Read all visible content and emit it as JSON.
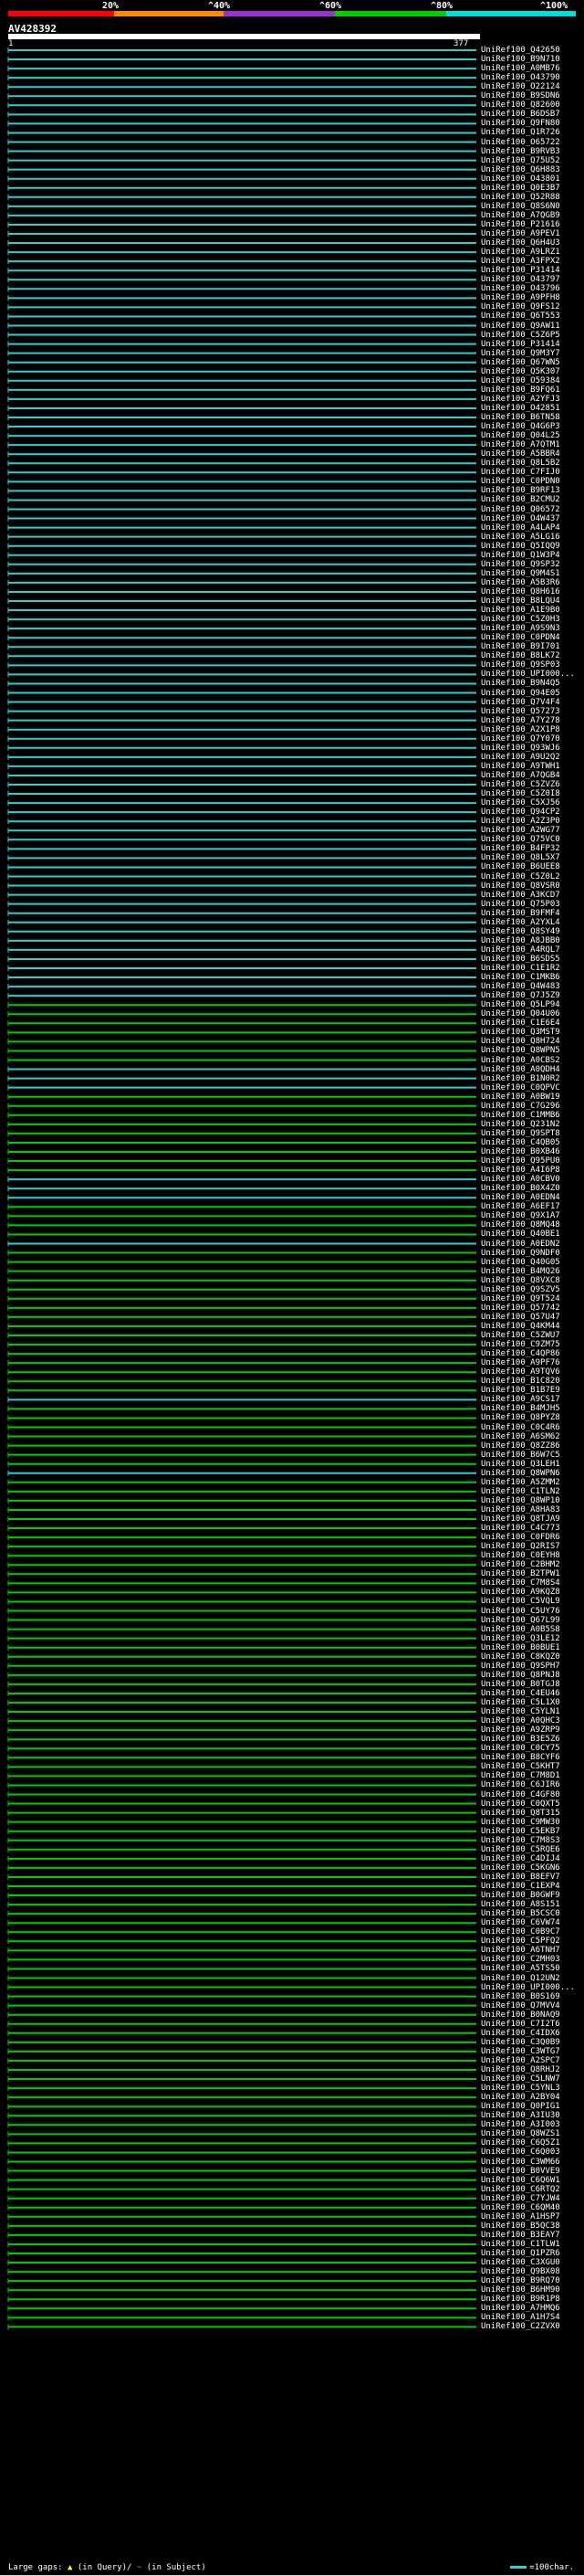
{
  "scale": {
    "labels": [
      "20%",
      "^40%",
      "^60%",
      "^80%",
      "^100%"
    ],
    "colors": [
      "#ff0000",
      "#ff8c00",
      "#9932cc",
      "#00cc00",
      "#00dddd"
    ]
  },
  "query": {
    "id": "AV428392",
    "start": "1",
    "end": "377"
  },
  "footer": {
    "gaps_label": "Large gaps:",
    "query_gap": "(in Query)/",
    "subject_gap": "(in Subject)",
    "legend_label": "=100char."
  },
  "hits": [
    {
      "id": "UniRef100_Q42650",
      "color": "#3cc"
    },
    {
      "id": "UniRef100_B9N710",
      "color": "#3cc"
    },
    {
      "id": "UniRef100_A0MB76",
      "color": "#3cc"
    },
    {
      "id": "UniRef100_O43790",
      "color": "#3cc"
    },
    {
      "id": "UniRef100_O22124",
      "color": "#3cc"
    },
    {
      "id": "UniRef100_B9SDN6",
      "color": "#3cc"
    },
    {
      "id": "UniRef100_Q82600",
      "color": "#3cc"
    },
    {
      "id": "UniRef100_B6DSB7",
      "color": "#3cc"
    },
    {
      "id": "UniRef100_Q9FN80",
      "color": "#3cc"
    },
    {
      "id": "UniRef100_Q1R726",
      "color": "#3cc"
    },
    {
      "id": "UniRef100_O65722",
      "color": "#3cc"
    },
    {
      "id": "UniRef100_B9RVB3",
      "color": "#3cc"
    },
    {
      "id": "UniRef100_Q75U52",
      "color": "#3cc"
    },
    {
      "id": "UniRef100_Q6H883",
      "color": "#3cc"
    },
    {
      "id": "UniRef100_O43801",
      "color": "#3cc"
    },
    {
      "id": "UniRef100_Q0E3B7",
      "color": "#3cc"
    },
    {
      "id": "UniRef100_Q52R88",
      "color": "#3cc"
    },
    {
      "id": "UniRef100_Q8S6N0",
      "color": "#3cc"
    },
    {
      "id": "UniRef100_A7QGB9",
      "color": "#3cc"
    },
    {
      "id": "UniRef100_P21616",
      "color": "#3cc"
    },
    {
      "id": "UniRef100_A9PEV1",
      "color": "#3cc"
    },
    {
      "id": "UniRef100_Q6H4U3",
      "color": "#3cc"
    },
    {
      "id": "UniRef100_A9LRZ1",
      "color": "#3cc"
    },
    {
      "id": "UniRef100_A3FPX2",
      "color": "#3cc"
    },
    {
      "id": "UniRef100_P31414",
      "color": "#3cc"
    },
    {
      "id": "UniRef100_O43797",
      "color": "#3cc"
    },
    {
      "id": "UniRef100_O43796",
      "color": "#3cc"
    },
    {
      "id": "UniRef100_A9PFH8",
      "color": "#3cc"
    },
    {
      "id": "UniRef100_Q9FS12",
      "color": "#3cc"
    },
    {
      "id": "UniRef100_Q6T553",
      "color": "#3cc"
    },
    {
      "id": "UniRef100_Q9AW11",
      "color": "#3cc"
    },
    {
      "id": "UniRef100_C5Z6P5",
      "color": "#3cc"
    },
    {
      "id": "UniRef100_P31414",
      "color": "#3cc"
    },
    {
      "id": "UniRef100_Q9M3Y7",
      "color": "#3cc"
    },
    {
      "id": "UniRef100_Q67WN5",
      "color": "#3cc"
    },
    {
      "id": "UniRef100_Q5K307",
      "color": "#3cc"
    },
    {
      "id": "UniRef100_O59384",
      "color": "#3cc"
    },
    {
      "id": "UniRef100_B9FQ61",
      "color": "#3cc"
    },
    {
      "id": "UniRef100_A2YFJ3",
      "color": "#3cc"
    },
    {
      "id": "UniRef100_O42851",
      "color": "#3cc"
    },
    {
      "id": "UniRef100_B6TN58",
      "color": "#3cc"
    },
    {
      "id": "UniRef100_Q4G6P3",
      "color": "#3cc"
    },
    {
      "id": "UniRef100_Q04L25",
      "color": "#3cc"
    },
    {
      "id": "UniRef100_A7QTM1",
      "color": "#3cc"
    },
    {
      "id": "UniRef100_A5BBR4",
      "color": "#3cc"
    },
    {
      "id": "UniRef100_Q8L5B2",
      "color": "#3cc"
    },
    {
      "id": "UniRef100_C7FIJ0",
      "color": "#3cc"
    },
    {
      "id": "UniRef100_C0PDN0",
      "color": "#3cc"
    },
    {
      "id": "UniRef100_B9RF13",
      "color": "#3cc"
    },
    {
      "id": "UniRef100_B2CMU2",
      "color": "#3cc"
    },
    {
      "id": "UniRef100_Q06572",
      "color": "#3cc"
    },
    {
      "id": "UniRef100_O4W437",
      "color": "#3cc"
    },
    {
      "id": "UniRef100_A4LAP4",
      "color": "#3cc"
    },
    {
      "id": "UniRef100_A5LG16",
      "color": "#3cc"
    },
    {
      "id": "UniRef100_Q5IQQ9",
      "color": "#3cc"
    },
    {
      "id": "UniRef100_Q1W3P4",
      "color": "#3cc"
    },
    {
      "id": "UniRef100_Q9SP32",
      "color": "#3cc"
    },
    {
      "id": "UniRef100_Q9M4S1",
      "color": "#3cc"
    },
    {
      "id": "UniRef100_A5B3R6",
      "color": "#3cc"
    },
    {
      "id": "UniRef100_Q8H616",
      "color": "#3cc"
    },
    {
      "id": "UniRef100_B8LQU4",
      "color": "#3cc"
    },
    {
      "id": "UniRef100_A1E9B0",
      "color": "#3cc"
    },
    {
      "id": "UniRef100_C5Z0H3",
      "color": "#3cc"
    },
    {
      "id": "UniRef100_A9S9N3",
      "color": "#3cc"
    },
    {
      "id": "UniRef100_C0PDN4",
      "color": "#3cc"
    },
    {
      "id": "UniRef100_B9I701",
      "color": "#3cc"
    },
    {
      "id": "UniRef100_B8LK72",
      "color": "#3cc"
    },
    {
      "id": "UniRef100_Q9SP03",
      "color": "#3cc"
    },
    {
      "id": "UniRef100_UPI000...",
      "color": "#3cc"
    },
    {
      "id": "UniRef100_B9N4Q5",
      "color": "#3cc"
    },
    {
      "id": "UniRef100_Q94E05",
      "color": "#3cc"
    },
    {
      "id": "UniRef100_Q7V4F4",
      "color": "#3cc"
    },
    {
      "id": "UniRef100_Q57273",
      "color": "#3cc"
    },
    {
      "id": "UniRef100_A7Y278",
      "color": "#3cc"
    },
    {
      "id": "UniRef100_A2X1P8",
      "color": "#3cc"
    },
    {
      "id": "UniRef100_Q7Y070",
      "color": "#3cc"
    },
    {
      "id": "UniRef100_Q93WJ6",
      "color": "#3cc"
    },
    {
      "id": "UniRef100_A9U2Q2",
      "color": "#3cc"
    },
    {
      "id": "UniRef100_A9TWH1",
      "color": "#3cc"
    },
    {
      "id": "UniRef100_A7QGB4",
      "color": "#3cc"
    },
    {
      "id": "UniRef100_C5ZVZ6",
      "color": "#3cc"
    },
    {
      "id": "UniRef100_C5Z0I8",
      "color": "#3cc"
    },
    {
      "id": "UniRef100_C5XJ56",
      "color": "#3cc"
    },
    {
      "id": "UniRef100_Q94CP2",
      "color": "#3cc"
    },
    {
      "id": "UniRef100_A2Z3P0",
      "color": "#3cc"
    },
    {
      "id": "UniRef100_A2WG77",
      "color": "#3cc"
    },
    {
      "id": "UniRef100_Q75VC0",
      "color": "#3cc"
    },
    {
      "id": "UniRef100_B4FP32",
      "color": "#3cc"
    },
    {
      "id": "UniRef100_Q8L5X7",
      "color": "#3cc"
    },
    {
      "id": "UniRef100_B6UEE8",
      "color": "#3cc"
    },
    {
      "id": "UniRef100_C5Z0L2",
      "color": "#3cc"
    },
    {
      "id": "UniRef100_Q8VSR0",
      "color": "#3cc"
    },
    {
      "id": "UniRef100_A3KCD7",
      "color": "#3cc"
    },
    {
      "id": "UniRef100_Q75P03",
      "color": "#3cc"
    },
    {
      "id": "UniRef100_B9FMF4",
      "color": "#3cc"
    },
    {
      "id": "UniRef100_A2YXL4",
      "color": "#3cc"
    },
    {
      "id": "UniRef100_Q8SY49",
      "color": "#3cc"
    },
    {
      "id": "UniRef100_A8JBB0",
      "color": "#3cc"
    },
    {
      "id": "UniRef100_A4RQL7",
      "color": "#3cc"
    },
    {
      "id": "UniRef100_B6SDS5",
      "color": "#3cc"
    },
    {
      "id": "UniRef100_C1E1R2",
      "color": "#3cc"
    },
    {
      "id": "UniRef100_C1MKB6",
      "color": "#3cc"
    },
    {
      "id": "UniRef100_Q4W483",
      "color": "#3cc"
    },
    {
      "id": "UniRef100_Q7J5Z9",
      "color": "#3cc"
    },
    {
      "id": "UniRef100_Q5LP94",
      "color": "#0c0"
    },
    {
      "id": "UniRef100_Q04U06",
      "color": "#0c0"
    },
    {
      "id": "UniRef100_C1E6E4",
      "color": "#0c0"
    },
    {
      "id": "UniRef100_Q3MST9",
      "color": "#0c0"
    },
    {
      "id": "UniRef100_Q8H724",
      "color": "#0c0"
    },
    {
      "id": "UniRef100_Q8WPN5",
      "color": "#0c0"
    },
    {
      "id": "UniRef100_A0CBS2",
      "color": "#0c0"
    },
    {
      "id": "UniRef100_A0QDH4",
      "color": "#3cc"
    },
    {
      "id": "UniRef100_B1N0R2",
      "color": "#3cc"
    },
    {
      "id": "UniRef100_C0QPVC",
      "color": "#3cc"
    },
    {
      "id": "UniRef100_A0BW19",
      "color": "#0c0"
    },
    {
      "id": "UniRef100_C7G296",
      "color": "#0c0"
    },
    {
      "id": "UniRef100_C1MMB6",
      "color": "#0c0"
    },
    {
      "id": "UniRef100_Q231N2",
      "color": "#0c0"
    },
    {
      "id": "UniRef100_Q9SPT8",
      "color": "#0c0"
    },
    {
      "id": "UniRef100_C4QB05",
      "color": "#0c0"
    },
    {
      "id": "UniRef100_B0XB46",
      "color": "#0c0"
    },
    {
      "id": "UniRef100_Q95PU0",
      "color": "#0c0"
    },
    {
      "id": "UniRef100_A4I6P8",
      "color": "#0c0"
    },
    {
      "id": "UniRef100_A0CBV0",
      "color": "#3cc"
    },
    {
      "id": "UniRef100_B0X4Z0",
      "color": "#3cc"
    },
    {
      "id": "UniRef100_A0EDN4",
      "color": "#3cc"
    },
    {
      "id": "UniRef100_A6EF17",
      "color": "#0c0"
    },
    {
      "id": "UniRef100_Q9X1A7",
      "color": "#0c0"
    },
    {
      "id": "UniRef100_Q8MQ48",
      "color": "#0c0"
    },
    {
      "id": "UniRef100_Q40BE1",
      "color": "#0c0"
    },
    {
      "id": "UniRef100_A0EDN2",
      "color": "#3cc"
    },
    {
      "id": "UniRef100_Q9NDF0",
      "color": "#0c0"
    },
    {
      "id": "UniRef100_Q40G05",
      "color": "#0c0"
    },
    {
      "id": "UniRef100_B4MQ26",
      "color": "#0c0"
    },
    {
      "id": "UniRef100_Q8VXC8",
      "color": "#0c0"
    },
    {
      "id": "UniRef100_Q9SZV5",
      "color": "#0c0"
    },
    {
      "id": "UniRef100_Q9T524",
      "color": "#0c0"
    },
    {
      "id": "UniRef100_Q57742",
      "color": "#0c0"
    },
    {
      "id": "UniRef100_Q57U47",
      "color": "#0c0"
    },
    {
      "id": "UniRef100_Q4KM44",
      "color": "#0c0"
    },
    {
      "id": "UniRef100_C5ZWU7",
      "color": "#0c0"
    },
    {
      "id": "UniRef100_C9ZM75",
      "color": "#0c0"
    },
    {
      "id": "UniRef100_C4QP86",
      "color": "#0c0"
    },
    {
      "id": "UniRef100_A9PF76",
      "color": "#0c0"
    },
    {
      "id": "UniRef100_A9TQV6",
      "color": "#0c0"
    },
    {
      "id": "UniRef100_B1C820",
      "color": "#0c0"
    },
    {
      "id": "UniRef100_B1B7E9",
      "color": "#0c0"
    },
    {
      "id": "UniRef100_A9CS17",
      "color": "#3cc"
    },
    {
      "id": "UniRef100_B4MJH5",
      "color": "#0c0"
    },
    {
      "id": "UniRef100_Q8PYZ8",
      "color": "#0c0"
    },
    {
      "id": "UniRef100_C0C4R6",
      "color": "#0c0"
    },
    {
      "id": "UniRef100_A6SM62",
      "color": "#0c0"
    },
    {
      "id": "UniRef100_Q8ZZ86",
      "color": "#0c0"
    },
    {
      "id": "UniRef100_B6W7C5",
      "color": "#0c0"
    },
    {
      "id": "UniRef100_Q3LEH1",
      "color": "#0c0"
    },
    {
      "id": "UniRef100_Q8WPN6",
      "color": "#3cc"
    },
    {
      "id": "UniRef100_A5ZMM2",
      "color": "#0c0"
    },
    {
      "id": "UniRef100_C1TLN2",
      "color": "#0c0"
    },
    {
      "id": "UniRef100_Q8WP10",
      "color": "#0c0"
    },
    {
      "id": "UniRef100_A8HA83",
      "color": "#0c0"
    },
    {
      "id": "UniRef100_Q8TJA9",
      "color": "#0c0"
    },
    {
      "id": "UniRef100_C4C773",
      "color": "#0c0"
    },
    {
      "id": "UniRef100_C0FDR6",
      "color": "#0c0"
    },
    {
      "id": "UniRef100_Q2RIS7",
      "color": "#0c0"
    },
    {
      "id": "UniRef100_C0EYH8",
      "color": "#0c0"
    },
    {
      "id": "UniRef100_C2BHM2",
      "color": "#0c0"
    },
    {
      "id": "UniRef100_B2TPW1",
      "color": "#0c0"
    },
    {
      "id": "UniRef100_C7M8S4",
      "color": "#0c0"
    },
    {
      "id": "UniRef100_A9KQZ8",
      "color": "#0c0"
    },
    {
      "id": "UniRef100_C5VQL9",
      "color": "#0c0"
    },
    {
      "id": "UniRef100_C5UY76",
      "color": "#0c0"
    },
    {
      "id": "UniRef100_Q67L99",
      "color": "#0c0"
    },
    {
      "id": "UniRef100_A0B5S8",
      "color": "#0c0"
    },
    {
      "id": "UniRef100_Q3LE12",
      "color": "#0c0"
    },
    {
      "id": "UniRef100_B0BUE1",
      "color": "#0c0"
    },
    {
      "id": "UniRef100_C8KQZ0",
      "color": "#0c0"
    },
    {
      "id": "UniRef100_Q9SPH7",
      "color": "#0c0"
    },
    {
      "id": "UniRef100_Q8PNJ8",
      "color": "#0c0"
    },
    {
      "id": "UniRef100_B0TGJ8",
      "color": "#0c0"
    },
    {
      "id": "UniRef100_C4EU46",
      "color": "#0c0"
    },
    {
      "id": "UniRef100_C5L1X0",
      "color": "#0c0"
    },
    {
      "id": "UniRef100_C5YLN1",
      "color": "#0c0"
    },
    {
      "id": "UniRef100_A0QHC3",
      "color": "#0c0"
    },
    {
      "id": "UniRef100_A9ZRP9",
      "color": "#0c0"
    },
    {
      "id": "UniRef100_B3E5Z6",
      "color": "#0c0"
    },
    {
      "id": "UniRef100_C0CY75",
      "color": "#0c0"
    },
    {
      "id": "UniRef100_B8CYF6",
      "color": "#0c0"
    },
    {
      "id": "UniRef100_C5KHT7",
      "color": "#0c0"
    },
    {
      "id": "UniRef100_C7M8D1",
      "color": "#0c0"
    },
    {
      "id": "UniRef100_C6JIR6",
      "color": "#0c0"
    },
    {
      "id": "UniRef100_C4GF80",
      "color": "#0c0"
    },
    {
      "id": "UniRef100_C0QXT5",
      "color": "#0c0"
    },
    {
      "id": "UniRef100_Q8T315",
      "color": "#0c0"
    },
    {
      "id": "UniRef100_C9MW30",
      "color": "#0c0"
    },
    {
      "id": "UniRef100_C5EKB7",
      "color": "#0c0"
    },
    {
      "id": "UniRef100_C7M8S3",
      "color": "#0c0"
    },
    {
      "id": "UniRef100_C5RQE6",
      "color": "#0c0"
    },
    {
      "id": "UniRef100_C4DIJ4",
      "color": "#0c0"
    },
    {
      "id": "UniRef100_C5KGN6",
      "color": "#0c0"
    },
    {
      "id": "UniRef100_B8EFV7",
      "color": "#0c0"
    },
    {
      "id": "UniRef100_C1EXP4",
      "color": "#0c0"
    },
    {
      "id": "UniRef100_B0GWF9",
      "color": "#0c0"
    },
    {
      "id": "UniRef100_A8S151",
      "color": "#0c0"
    },
    {
      "id": "UniRef100_B5CSC0",
      "color": "#0c0"
    },
    {
      "id": "UniRef100_C6VW74",
      "color": "#0c0"
    },
    {
      "id": "UniRef100_C0B9C7",
      "color": "#0c0"
    },
    {
      "id": "UniRef100_C5PFQ2",
      "color": "#0c0"
    },
    {
      "id": "UniRef100_A6TNH7",
      "color": "#0c0"
    },
    {
      "id": "UniRef100_C2MH03",
      "color": "#0c0"
    },
    {
      "id": "UniRef100_A5TS50",
      "color": "#0c0"
    },
    {
      "id": "UniRef100_Q12UN2",
      "color": "#0c0"
    },
    {
      "id": "UniRef100_UPI000...",
      "color": "#0c0"
    },
    {
      "id": "UniRef100_B0S169",
      "color": "#0c0"
    },
    {
      "id": "UniRef100_Q7MVV4",
      "color": "#0c0"
    },
    {
      "id": "UniRef100_B0NAQ9",
      "color": "#0c0"
    },
    {
      "id": "UniRef100_C7I2T6",
      "color": "#0c0"
    },
    {
      "id": "UniRef100_C4IDX6",
      "color": "#0c0"
    },
    {
      "id": "UniRef100_C3Q0B9",
      "color": "#0c0"
    },
    {
      "id": "UniRef100_C3WTG7",
      "color": "#0c0"
    },
    {
      "id": "UniRef100_A2SPC7",
      "color": "#0c0"
    },
    {
      "id": "UniRef100_Q8RHJ2",
      "color": "#0c0"
    },
    {
      "id": "UniRef100_C5LNW7",
      "color": "#0c0"
    },
    {
      "id": "UniRef100_C5YNL3",
      "color": "#0c0"
    },
    {
      "id": "UniRef100_A2BY04",
      "color": "#0c0"
    },
    {
      "id": "UniRef100_Q0PIG1",
      "color": "#0c0"
    },
    {
      "id": "UniRef100_A3IU30",
      "color": "#0c0"
    },
    {
      "id": "UniRef100_A3I003",
      "color": "#0c0"
    },
    {
      "id": "UniRef100_Q8WZS1",
      "color": "#0c0"
    },
    {
      "id": "UniRef100_C6Q5Z1",
      "color": "#0c0"
    },
    {
      "id": "UniRef100_C6Q003",
      "color": "#0c0"
    },
    {
      "id": "UniRef100_C3WM66",
      "color": "#0c0"
    },
    {
      "id": "UniRef100_B0VVE9",
      "color": "#0c0"
    },
    {
      "id": "UniRef100_C6Q6W1",
      "color": "#0c0"
    },
    {
      "id": "UniRef100_C6RTQ2",
      "color": "#0c0"
    },
    {
      "id": "UniRef100_C7YJW4",
      "color": "#0c0"
    },
    {
      "id": "UniRef100_C6QM40",
      "color": "#0c0"
    },
    {
      "id": "UniRef100_A1HSP7",
      "color": "#0c0"
    },
    {
      "id": "UniRef100_B5QC38",
      "color": "#0c0"
    },
    {
      "id": "UniRef100_B3EAY7",
      "color": "#0c0"
    },
    {
      "id": "UniRef100_C1TLW1",
      "color": "#0c0"
    },
    {
      "id": "UniRef100_Q1PZR6",
      "color": "#0c0"
    },
    {
      "id": "UniRef100_C3XGU0",
      "color": "#0c0"
    },
    {
      "id": "UniRef100_Q9BX08",
      "color": "#0c0"
    },
    {
      "id": "UniRef100_B9RQ70",
      "color": "#0c0"
    },
    {
      "id": "UniRef100_B6HM90",
      "color": "#0c0"
    },
    {
      "id": "UniRef100_B9R1P8",
      "color": "#0c0"
    },
    {
      "id": "UniRef100_A7HMQ6",
      "color": "#0c0"
    },
    {
      "id": "UniRef100_A1H7S4",
      "color": "#0c0"
    },
    {
      "id": "UniRef100_C2ZVX0",
      "color": "#0c0"
    }
  ]
}
